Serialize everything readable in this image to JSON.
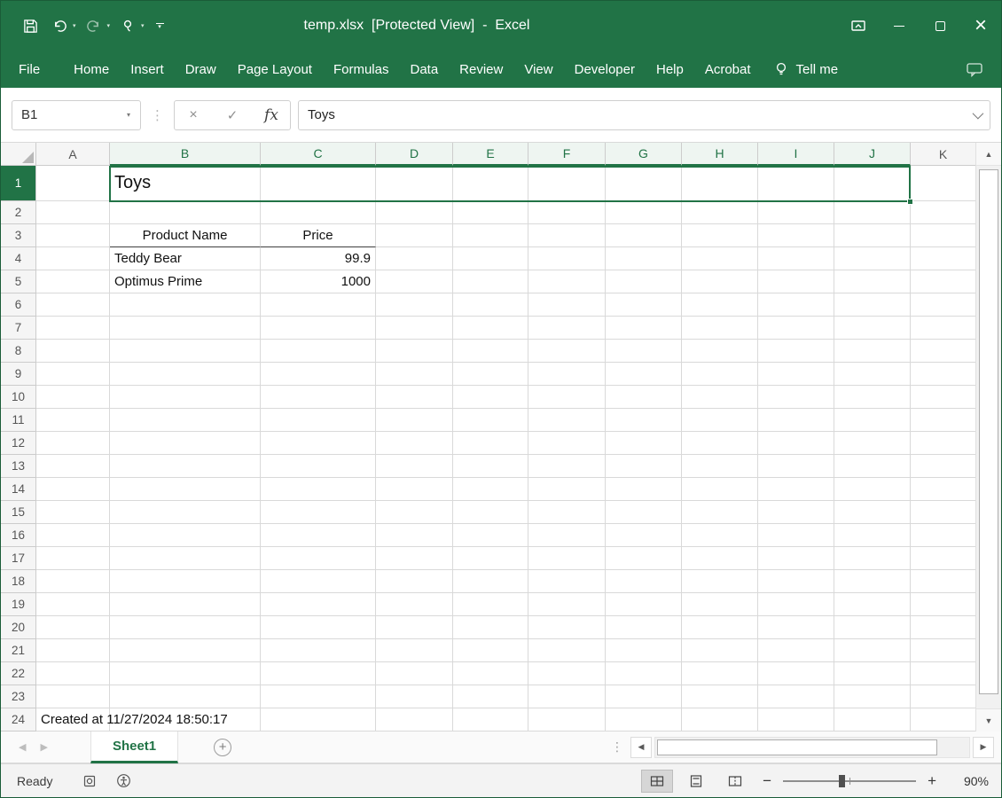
{
  "colors": {
    "accent": "#217346"
  },
  "title_bar": {
    "title": "temp.xlsx  [Protected View]  -  Excel"
  },
  "ribbon": {
    "tabs": [
      "File",
      "Home",
      "Insert",
      "Draw",
      "Page Layout",
      "Formulas",
      "Data",
      "Review",
      "View",
      "Developer",
      "Help",
      "Acrobat"
    ],
    "tell_me": "Tell me"
  },
  "formula_bar": {
    "name_box": "B1",
    "fx": "fx",
    "value": "Toys"
  },
  "grid": {
    "columns": [
      "A",
      "B",
      "C",
      "D",
      "E",
      "F",
      "G",
      "H",
      "I",
      "J",
      "K"
    ],
    "row_count": 24,
    "selected_range": "B1:J1",
    "selected_columns": [
      "B",
      "C",
      "D",
      "E",
      "F",
      "G",
      "H",
      "I",
      "J"
    ],
    "selected_rows": [
      1
    ],
    "cells": [
      {
        "ref": "B1",
        "text": "Toys",
        "style": "title"
      },
      {
        "ref": "B3",
        "text": "Product Name",
        "style": "colhead"
      },
      {
        "ref": "C3",
        "text": "Price",
        "style": "colhead"
      },
      {
        "ref": "B4",
        "text": "Teddy Bear",
        "style": "text"
      },
      {
        "ref": "C4",
        "text": "99.9",
        "style": "number"
      },
      {
        "ref": "B5",
        "text": "Optimus Prime",
        "style": "text"
      },
      {
        "ref": "C5",
        "text": "1000",
        "style": "number"
      },
      {
        "ref": "A24",
        "text": "Created at 11/27/2024 18:50:17",
        "style": "text"
      }
    ]
  },
  "sheet_bar": {
    "active_tab": "Sheet1"
  },
  "status_bar": {
    "mode": "Ready",
    "zoom": "90%"
  }
}
